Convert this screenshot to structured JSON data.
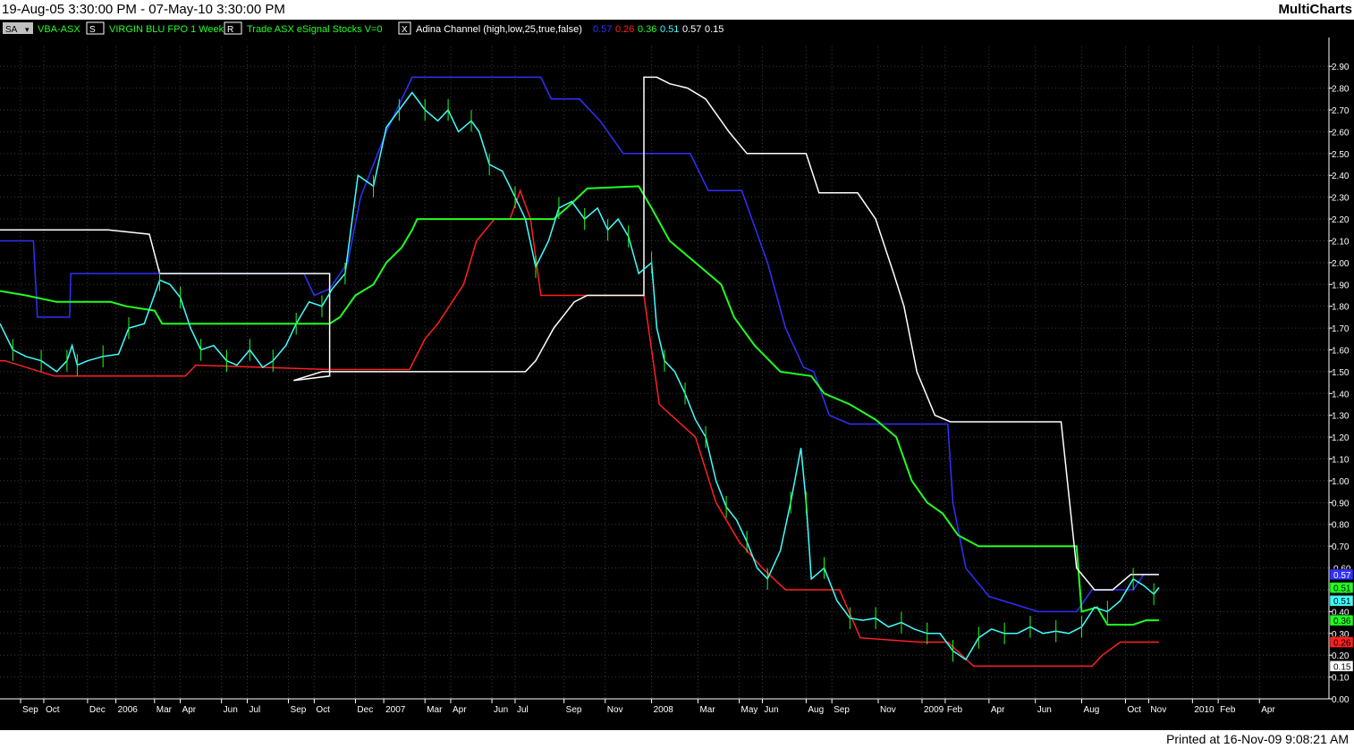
{
  "window": {
    "date_range": "19-Aug-05 3:30:00 PM - 07-May-10 3:30:00 PM",
    "brand": "MultiCharts",
    "printed": "Printed at 16-Nov-09 9:08:21 AM"
  },
  "header": {
    "sa_button": "SA",
    "symbol": "VBA-ASX",
    "s_button": "S",
    "description": "VIRGIN BLU FPO  1 Week",
    "r_button": "R",
    "source": "Trade  ASX  eSignal  Stocks  V=0",
    "x_button": "X",
    "indicator": "Adina Channel  (high,low,25,true,false)",
    "indicator_values": [
      {
        "text": "0.57",
        "color": "#3030ff"
      },
      {
        "text": "0.26",
        "color": "#ff2020"
      },
      {
        "text": "0.36",
        "color": "#20ff20"
      },
      {
        "text": "0.51",
        "color": "#40ffff"
      },
      {
        "text": "0.57",
        "color": "#ffffff"
      },
      {
        "text": "0.15",
        "color": "#ffffff"
      }
    ]
  },
  "chart_data": {
    "type": "line",
    "title": "VIRGIN BLU FPO 1 Week",
    "xlabel": "",
    "ylabel": "",
    "ylim": [
      0,
      2.95
    ],
    "grid": true,
    "y_ticks": [
      "2.90",
      "2.80",
      "2.70",
      "2.60",
      "2.50",
      "2.40",
      "2.30",
      "2.20",
      "2.10",
      "2.00",
      "1.90",
      "1.80",
      "1.70",
      "1.60",
      "1.50",
      "1.40",
      "1.30",
      "1.20",
      "1.10",
      "1.00",
      "0.90",
      "0.80",
      "0.70",
      "0.60",
      "0.50",
      "0.40",
      "0.30",
      "0.20",
      "0.10",
      "0.00"
    ],
    "x_tick_labels": [
      {
        "label": "Sep",
        "t": 0.8
      },
      {
        "label": "Oct",
        "t": 1.7
      },
      {
        "label": "Dec",
        "t": 3.4
      },
      {
        "label": "2006",
        "t": 4.5
      },
      {
        "label": "Mar",
        "t": 6.0
      },
      {
        "label": "Apr",
        "t": 7.0
      },
      {
        "label": "Jun",
        "t": 8.6
      },
      {
        "label": "Jul",
        "t": 9.6
      },
      {
        "label": "Sep",
        "t": 11.2
      },
      {
        "label": "Oct",
        "t": 12.2
      },
      {
        "label": "Dec",
        "t": 13.8
      },
      {
        "label": "2007",
        "t": 14.9
      },
      {
        "label": "Mar",
        "t": 16.5
      },
      {
        "label": "Apr",
        "t": 17.5
      },
      {
        "label": "Jun",
        "t": 19.1
      },
      {
        "label": "Jul",
        "t": 20.0
      },
      {
        "label": "Sep",
        "t": 21.9
      },
      {
        "label": "Nov",
        "t": 23.5
      },
      {
        "label": "2008",
        "t": 25.3
      },
      {
        "label": "Mar",
        "t": 27.1
      },
      {
        "label": "May",
        "t": 28.7
      },
      {
        "label": "Jun",
        "t": 29.6
      },
      {
        "label": "Aug",
        "t": 31.3
      },
      {
        "label": "Sep",
        "t": 32.3
      },
      {
        "label": "Nov",
        "t": 34.1
      },
      {
        "label": "2009",
        "t": 35.8
      },
      {
        "label": "Feb",
        "t": 36.7
      },
      {
        "label": "Apr",
        "t": 38.4
      },
      {
        "label": "Jun",
        "t": 40.2
      },
      {
        "label": "Aug",
        "t": 42.0
      },
      {
        "label": "Oct",
        "t": 43.7
      },
      {
        "label": "Nov",
        "t": 44.6
      },
      {
        "label": "2010",
        "t": 46.3
      },
      {
        "label": "Feb",
        "t": 47.3
      },
      {
        "label": "Apr",
        "t": 48.9
      }
    ],
    "series": [
      {
        "color": "#3030ff",
        "points": [
          [
            0.0,
            2.1
          ],
          [
            1.3,
            2.1
          ],
          [
            1.45,
            1.75
          ],
          [
            2.7,
            1.75
          ],
          [
            2.75,
            1.95
          ],
          [
            11.8,
            1.95
          ],
          [
            12.2,
            1.85
          ],
          [
            12.8,
            1.88
          ],
          [
            13.5,
            2.0
          ],
          [
            14.0,
            2.3
          ],
          [
            15.0,
            2.6
          ],
          [
            16.0,
            2.85
          ],
          [
            21.0,
            2.85
          ],
          [
            21.4,
            2.75
          ],
          [
            22.5,
            2.75
          ],
          [
            23.3,
            2.65
          ],
          [
            24.2,
            2.5
          ],
          [
            26.8,
            2.5
          ],
          [
            27.5,
            2.33
          ],
          [
            28.8,
            2.33
          ],
          [
            29.8,
            2.0
          ],
          [
            30.5,
            1.7
          ],
          [
            31.2,
            1.52
          ],
          [
            31.6,
            1.5
          ],
          [
            32.2,
            1.3
          ],
          [
            33.0,
            1.26
          ],
          [
            36.8,
            1.26
          ],
          [
            37.0,
            0.9
          ],
          [
            37.5,
            0.6
          ],
          [
            38.4,
            0.47
          ],
          [
            40.3,
            0.4
          ],
          [
            41.8,
            0.4
          ],
          [
            42.4,
            0.5
          ],
          [
            44.0,
            0.5
          ],
          [
            44.4,
            0.57
          ],
          [
            45.0,
            0.57
          ]
        ]
      },
      {
        "color": "#ff2020",
        "points": [
          [
            0.0,
            1.55
          ],
          [
            0.2,
            1.55
          ],
          [
            2.1,
            1.48
          ],
          [
            7.2,
            1.48
          ],
          [
            7.6,
            1.53
          ],
          [
            12.8,
            1.51
          ],
          [
            15.9,
            1.51
          ],
          [
            16.5,
            1.65
          ],
          [
            17.0,
            1.72
          ],
          [
            18.0,
            1.9
          ],
          [
            18.5,
            2.1
          ],
          [
            19.2,
            2.2
          ],
          [
            19.8,
            2.2
          ],
          [
            20.2,
            2.33
          ],
          [
            20.6,
            2.2
          ],
          [
            21.0,
            1.85
          ],
          [
            25.0,
            1.85
          ],
          [
            25.3,
            1.6
          ],
          [
            25.6,
            1.35
          ],
          [
            27.0,
            1.2
          ],
          [
            27.8,
            0.9
          ],
          [
            28.7,
            0.72
          ],
          [
            29.6,
            0.6
          ],
          [
            30.5,
            0.5
          ],
          [
            32.6,
            0.5
          ],
          [
            33.4,
            0.28
          ],
          [
            35.7,
            0.26
          ],
          [
            36.8,
            0.26
          ],
          [
            37.8,
            0.15
          ],
          [
            42.4,
            0.15
          ],
          [
            42.8,
            0.2
          ],
          [
            43.5,
            0.26
          ],
          [
            45.0,
            0.26
          ]
        ]
      },
      {
        "color": "#20ff20",
        "points": [
          [
            0.0,
            1.87
          ],
          [
            1.0,
            1.85
          ],
          [
            2.2,
            1.82
          ],
          [
            4.3,
            1.82
          ],
          [
            4.9,
            1.8
          ],
          [
            6.0,
            1.78
          ],
          [
            6.3,
            1.72
          ],
          [
            12.8,
            1.72
          ],
          [
            13.2,
            1.75
          ],
          [
            13.8,
            1.85
          ],
          [
            14.5,
            1.9
          ],
          [
            15.0,
            2.0
          ],
          [
            15.6,
            2.07
          ],
          [
            16.0,
            2.15
          ],
          [
            16.2,
            2.2
          ],
          [
            21.5,
            2.2
          ],
          [
            22.0,
            2.25
          ],
          [
            22.8,
            2.34
          ],
          [
            24.8,
            2.35
          ],
          [
            25.3,
            2.25
          ],
          [
            26.0,
            2.1
          ],
          [
            27.0,
            2.0
          ],
          [
            28.0,
            1.9
          ],
          [
            28.5,
            1.75
          ],
          [
            29.3,
            1.62
          ],
          [
            30.3,
            1.5
          ],
          [
            31.5,
            1.48
          ],
          [
            32.0,
            1.4
          ],
          [
            33.0,
            1.35
          ],
          [
            34.0,
            1.28
          ],
          [
            34.8,
            1.2
          ],
          [
            35.4,
            1.0
          ],
          [
            36.0,
            0.9
          ],
          [
            36.6,
            0.85
          ],
          [
            37.2,
            0.75
          ],
          [
            38.0,
            0.7
          ],
          [
            41.8,
            0.7
          ],
          [
            42.0,
            0.4
          ],
          [
            42.6,
            0.42
          ],
          [
            43.0,
            0.34
          ],
          [
            44.0,
            0.34
          ],
          [
            44.5,
            0.36
          ],
          [
            45.0,
            0.36
          ]
        ]
      },
      {
        "color": "#ffffff",
        "points": [
          [
            0.0,
            2.15
          ],
          [
            4.2,
            2.15
          ],
          [
            5.8,
            2.13
          ],
          [
            6.2,
            1.95
          ],
          [
            12.8,
            1.95
          ],
          [
            12.8,
            1.48
          ],
          [
            11.4,
            1.46
          ],
          [
            12.5,
            1.5
          ],
          [
            20.4,
            1.5
          ],
          [
            20.8,
            1.55
          ],
          [
            21.5,
            1.7
          ],
          [
            22.3,
            1.82
          ],
          [
            22.8,
            1.85
          ],
          [
            25.0,
            1.85
          ],
          [
            25.0,
            2.85
          ],
          [
            25.5,
            2.85
          ],
          [
            26.0,
            2.82
          ],
          [
            26.7,
            2.8
          ],
          [
            27.4,
            2.75
          ],
          [
            28.3,
            2.6
          ],
          [
            29.0,
            2.5
          ],
          [
            31.3,
            2.5
          ],
          [
            31.8,
            2.32
          ],
          [
            33.3,
            2.32
          ],
          [
            34.0,
            2.2
          ],
          [
            34.7,
            1.95
          ],
          [
            35.1,
            1.8
          ],
          [
            35.6,
            1.5
          ],
          [
            36.3,
            1.3
          ],
          [
            36.9,
            1.27
          ],
          [
            41.2,
            1.27
          ],
          [
            41.8,
            0.6
          ],
          [
            42.5,
            0.5
          ],
          [
            43.2,
            0.5
          ],
          [
            43.9,
            0.57
          ],
          [
            45.0,
            0.57
          ]
        ]
      },
      {
        "color": "#40ffff",
        "points": [
          [
            0.0,
            1.72
          ],
          [
            0.5,
            1.6
          ],
          [
            1.0,
            1.57
          ],
          [
            1.6,
            1.55
          ],
          [
            2.2,
            1.5
          ],
          [
            2.6,
            1.55
          ],
          [
            2.8,
            1.62
          ],
          [
            3.0,
            1.53
          ],
          [
            3.4,
            1.55
          ],
          [
            4.0,
            1.57
          ],
          [
            4.6,
            1.58
          ],
          [
            5.0,
            1.7
          ],
          [
            5.6,
            1.72
          ],
          [
            6.2,
            1.92
          ],
          [
            6.6,
            1.9
          ],
          [
            7.0,
            1.84
          ],
          [
            7.4,
            1.7
          ],
          [
            7.8,
            1.6
          ],
          [
            8.3,
            1.62
          ],
          [
            8.8,
            1.55
          ],
          [
            9.2,
            1.53
          ],
          [
            9.7,
            1.6
          ],
          [
            10.2,
            1.52
          ],
          [
            10.6,
            1.55
          ],
          [
            11.1,
            1.62
          ],
          [
            11.5,
            1.72
          ],
          [
            12.0,
            1.82
          ],
          [
            12.5,
            1.8
          ],
          [
            12.9,
            1.88
          ],
          [
            13.4,
            1.95
          ],
          [
            13.9,
            2.4
          ],
          [
            14.5,
            2.35
          ],
          [
            15.0,
            2.62
          ],
          [
            15.5,
            2.7
          ],
          [
            16.0,
            2.78
          ],
          [
            16.5,
            2.7
          ],
          [
            17.0,
            2.65
          ],
          [
            17.4,
            2.7
          ],
          [
            17.8,
            2.6
          ],
          [
            18.3,
            2.65
          ],
          [
            18.6,
            2.6
          ],
          [
            19.0,
            2.45
          ],
          [
            19.5,
            2.42
          ],
          [
            20.0,
            2.3
          ],
          [
            20.4,
            2.2
          ],
          [
            20.8,
            1.98
          ],
          [
            21.3,
            2.1
          ],
          [
            21.7,
            2.25
          ],
          [
            22.2,
            2.28
          ],
          [
            22.7,
            2.2
          ],
          [
            23.2,
            2.25
          ],
          [
            23.6,
            2.15
          ],
          [
            24.0,
            2.2
          ],
          [
            24.4,
            2.12
          ],
          [
            24.8,
            1.95
          ],
          [
            25.3,
            2.0
          ],
          [
            25.5,
            1.7
          ],
          [
            25.8,
            1.55
          ],
          [
            26.2,
            1.5
          ],
          [
            26.6,
            1.4
          ],
          [
            27.0,
            1.28
          ],
          [
            27.4,
            1.2
          ],
          [
            27.8,
            1.0
          ],
          [
            28.2,
            0.88
          ],
          [
            28.6,
            0.82
          ],
          [
            29.0,
            0.72
          ],
          [
            29.4,
            0.6
          ],
          [
            29.8,
            0.55
          ],
          [
            30.3,
            0.68
          ],
          [
            30.7,
            0.9
          ],
          [
            31.1,
            1.15
          ],
          [
            31.3,
            0.9
          ],
          [
            31.5,
            0.55
          ],
          [
            32.0,
            0.6
          ],
          [
            32.5,
            0.45
          ],
          [
            33.0,
            0.37
          ],
          [
            33.5,
            0.36
          ],
          [
            34.0,
            0.37
          ],
          [
            34.5,
            0.33
          ],
          [
            35.0,
            0.35
          ],
          [
            35.5,
            0.32
          ],
          [
            36.0,
            0.3
          ],
          [
            36.5,
            0.3
          ],
          [
            37.0,
            0.22
          ],
          [
            37.5,
            0.18
          ],
          [
            38.0,
            0.28
          ],
          [
            38.5,
            0.32
          ],
          [
            39.0,
            0.3
          ],
          [
            39.5,
            0.3
          ],
          [
            40.0,
            0.33
          ],
          [
            40.5,
            0.3
          ],
          [
            41.0,
            0.31
          ],
          [
            41.5,
            0.3
          ],
          [
            42.0,
            0.33
          ],
          [
            42.5,
            0.42
          ],
          [
            43.0,
            0.4
          ],
          [
            43.5,
            0.45
          ],
          [
            44.0,
            0.55
          ],
          [
            44.4,
            0.52
          ],
          [
            44.8,
            0.48
          ],
          [
            45.0,
            0.51
          ]
        ]
      }
    ],
    "price_labels": [
      {
        "text": "0.60",
        "value": 0.6,
        "bg": "#000000",
        "fg": "#ffffff"
      },
      {
        "text": "0.57",
        "value": 0.57,
        "bg": "#3030ff",
        "fg": "#ffffff"
      },
      {
        "text": "0.51",
        "value": 0.51,
        "bg": "#20ff20",
        "fg": "#000000"
      },
      {
        "text": "0.51",
        "value": 0.45,
        "bg": "#40ffff",
        "fg": "#000000"
      },
      {
        "text": "0.36",
        "value": 0.36,
        "bg": "#20ff20",
        "fg": "#000000"
      },
      {
        "text": "0.26",
        "value": 0.26,
        "bg": "#ff2020",
        "fg": "#000000"
      },
      {
        "text": "0.15",
        "value": 0.15,
        "bg": "#ffffff",
        "fg": "#000000"
      }
    ]
  }
}
